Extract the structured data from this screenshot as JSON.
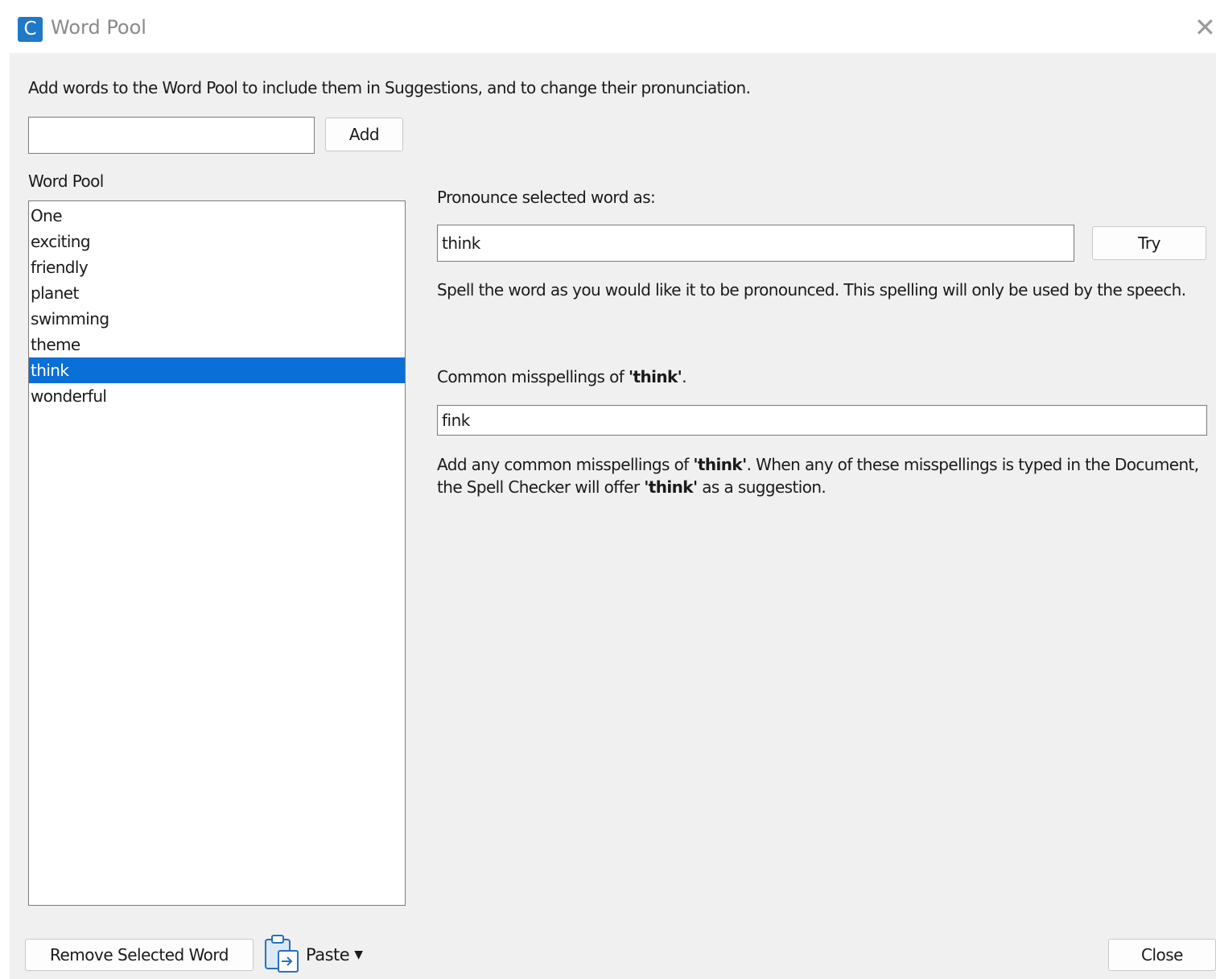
{
  "window": {
    "app_icon_letter": "C",
    "title": "Word Pool",
    "close_glyph": "✕"
  },
  "intro_text": "Add words to the Word Pool to include them in Suggestions, and to change their pronunciation.",
  "add_input": {
    "value": ""
  },
  "add_button": "Add",
  "word_pool": {
    "label": "Word Pool",
    "items": [
      "One",
      "exciting",
      "friendly",
      "planet",
      "swimming",
      "theme",
      "think",
      "wonderful"
    ],
    "selected_index": 6
  },
  "pronounce": {
    "label": "Pronounce selected word as:",
    "value": "think",
    "try_button": "Try",
    "help": "Spell the word as you would like it to be pronounced. This spelling will only be used by the speech."
  },
  "misspellings": {
    "label_prefix": "Common misspellings of ",
    "word": "'think'",
    "label_suffix": ".",
    "value": "fink",
    "help_part1": "Add any common misspellings of ",
    "help_word1": "'think'",
    "help_part2": ". When any of these misspellings is typed in the Document,",
    "help_part3": "the Spell Checker will offer ",
    "help_word2": "'think'",
    "help_part4": " as a suggestion."
  },
  "footer": {
    "remove_button": "Remove Selected Word",
    "paste_label": "Paste",
    "close_button": "Close"
  },
  "icons": {
    "app": "app-logo-icon",
    "close": "close-icon",
    "paste": "clipboard-paste-icon",
    "dropdown": "caret-down-icon"
  },
  "colors": {
    "selection": "#0a6fd6",
    "app_icon": "#1f78c8",
    "dialog_bg": "#f0f0f0"
  }
}
